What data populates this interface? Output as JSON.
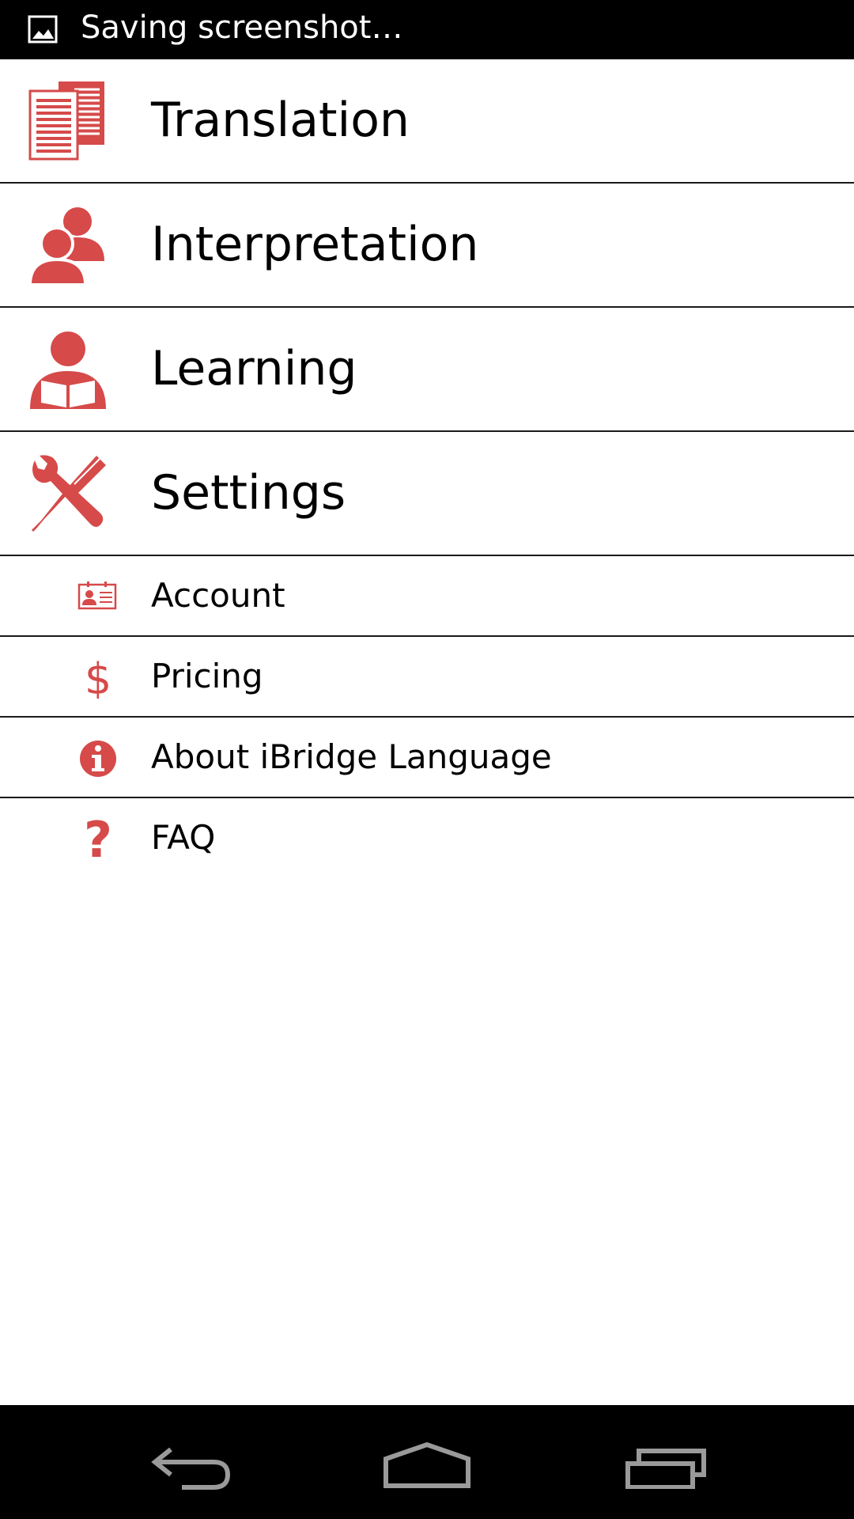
{
  "status_bar": {
    "text": "Saving screenshot…",
    "icon": "image-icon"
  },
  "colors": {
    "accent": "#d64a4a",
    "divider": "#1a1a1a",
    "text": "#000000",
    "background": "#ffffff"
  },
  "menu": {
    "main_items": [
      {
        "label": "Translation",
        "icon": "documents-icon"
      },
      {
        "label": "Interpretation",
        "icon": "people-icon"
      },
      {
        "label": "Learning",
        "icon": "person-reading-icon"
      },
      {
        "label": "Settings",
        "icon": "tools-icon"
      }
    ],
    "sub_items": [
      {
        "label": "Account",
        "icon": "id-card-icon"
      },
      {
        "label": "Pricing",
        "icon": "dollar-icon"
      },
      {
        "label": "About iBridge Language",
        "icon": "info-icon"
      },
      {
        "label": "FAQ",
        "icon": "question-icon"
      }
    ]
  },
  "nav_bar": {
    "buttons": [
      {
        "icon": "back-icon"
      },
      {
        "icon": "home-icon"
      },
      {
        "icon": "recent-apps-icon"
      }
    ]
  }
}
